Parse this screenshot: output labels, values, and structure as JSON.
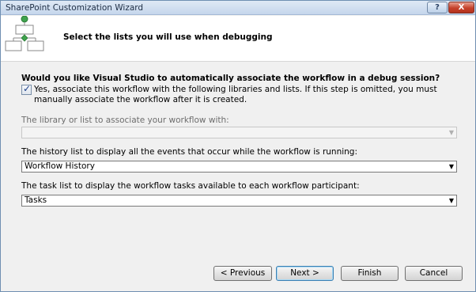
{
  "window": {
    "title": "SharePoint Customization Wizard",
    "help_label": "?",
    "close_label": "X"
  },
  "header": {
    "title": "Select the lists you will use when debugging",
    "icon": "workflow-diagram-icon"
  },
  "question": "Would you like Visual Studio to automatically associate the workflow in a debug session?",
  "associate_checkbox": {
    "checked": true,
    "label": "Yes, associate this workflow with the following libraries and lists. If this step is omitted, you must manually associate the workflow after it is created."
  },
  "library_field": {
    "label": "The library or list to associate your workflow with:",
    "value": "",
    "enabled": false
  },
  "history_field": {
    "label": "The history list to display all the events that occur while the workflow is running:",
    "value": "Workflow History",
    "enabled": true
  },
  "task_field": {
    "label": "The task list to display the workflow tasks available to each workflow participant:",
    "value": "Tasks",
    "enabled": true
  },
  "buttons": {
    "previous": "< Previous",
    "next": "Next >",
    "finish": "Finish",
    "cancel": "Cancel"
  }
}
